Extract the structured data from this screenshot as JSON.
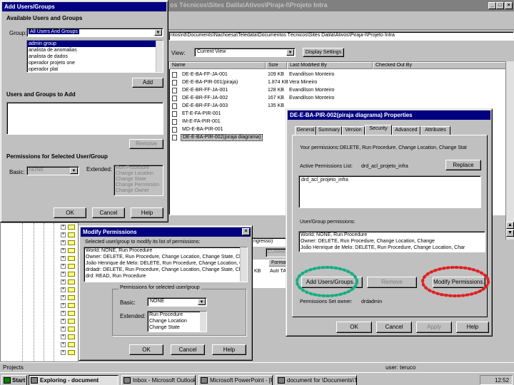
{
  "explorer": {
    "title_fragment": "os Técnicos\\Sites Dalila\\Ativos\\Piraja-I\\Projeto Intra",
    "address_fragment": "ntos\\rd\\Documents\\Nachoesa\\Teledata\\Documentos Técnicos\\Sites Dalila\\Ativos\\Piraja-I\\Projeto Intra",
    "view_label": "View:",
    "view_value": "Current View",
    "display_settings": "Display Settings",
    "columns": {
      "name": "Name",
      "size": "Size",
      "modified_by": "Last Modified By",
      "checked_out_by": "Checked Out By"
    },
    "files": [
      {
        "name": "DE-E-BA-FF-JA-001",
        "size": "109 KB",
        "by": "Evandilson Monteiro"
      },
      {
        "name": "DE-E-BA-PIR-001(piraja)",
        "size": "1.874 KB",
        "by": "Vera Mineiro"
      },
      {
        "name": "DE-E-BR-FF-JA-001",
        "size": "128 KB",
        "by": "Evandilson Monteiro"
      },
      {
        "name": "DE-E-BR-FF-JA-002",
        "size": "167 KB",
        "by": "Evandilson Monteiro"
      },
      {
        "name": "DE-E-BR-FF-JA-003",
        "size": "135 KB",
        "by": ""
      },
      {
        "name": "ET-E-FA-PIR-001",
        "size": "",
        "by": ""
      },
      {
        "name": "IM-E-FA-PIR-001",
        "size": "",
        "by": ""
      },
      {
        "name": "MD-E-BA-PIR-001",
        "size": "",
        "by": ""
      },
      {
        "name": "DE-E-BA-PIR-002(piraja diagrama)",
        "size": "",
        "by": ""
      }
    ],
    "lower_tab_fragment": "ngresso)",
    "lower_header_fragment": "Forma",
    "lower_input_value": "CURRE",
    "lower_row": {
      "size": "KB",
      "author": "Autr TA"
    },
    "status_left": "Projects",
    "status_right": "user: teruco"
  },
  "add_users": {
    "title": "Add Users/Groups",
    "available_label": "Available Users and Groups",
    "group_label": "Group:",
    "group_value": "All Users And Groups",
    "users": [
      "admin group",
      "analista de anomalias",
      "analista de dados",
      "operador projeto one",
      "operador plat"
    ],
    "add_button": "Add",
    "users_to_add_label": "Users and Groups to Add",
    "remove_button": "Remove",
    "permissions_label": "Permissions for Selected User/Group",
    "basic_label": "Basic:",
    "basic_value": "NONE",
    "extended_label": "Extended:",
    "extended_items": [
      "Run Procedure",
      "Change Location",
      "Change State",
      "Change Permission",
      "Change Owner"
    ],
    "ok": "OK",
    "cancel": "Cancel",
    "help": "Help"
  },
  "modify": {
    "title": "Modify Permissions",
    "list_label": "Selected user/group to modify its list of permissions:",
    "entries": [
      "World: NONE, Run Procedure",
      "Owner: DELETE, Run Procedure, Change Location, Change State, Ch",
      "João Henrique de Melo: DELETE, Run Procedure, Change Location, C",
      "drdadr: DELETE, Run Procedure, Change Location, Change State, Cha",
      "drd: READ, Run Procedure"
    ],
    "group_label": "Permissions for selected user/group",
    "basic_label": "Basic:",
    "basic_value": "NONE",
    "extended_label": "Extended:",
    "extended_items": [
      "Run Procedure",
      "Change Location",
      "Change State"
    ],
    "ok": "OK",
    "cancel": "Cancel",
    "help": "Help"
  },
  "properties": {
    "title": "DE-E-BA-PIR-002(piraja diagrama) Properties",
    "tabs": [
      "General",
      "Summary",
      "Version",
      "Security",
      "Advanced",
      "Attributes"
    ],
    "your_permissions_label": "Your permissions:",
    "your_permissions_value": "DELETE, Run Procedure, Change Location, Change Stat",
    "active_list_label": "Active Permissions List:",
    "active_list_value": "drd_acl_projeto_infra",
    "replace_button": "Replace",
    "active_list_content": "drd_acl_projeto_infra",
    "user_group_label": "User/Group permissions:",
    "entries": [
      "World: NONE, Run Procedure",
      "Owner: DELETE, Run Procedure, Change Location, Change",
      "João Henrique de Melo: DELETE, Run Procedure, Change Location, Char"
    ],
    "add_button": "Add Users/Groups...",
    "remove_button": "Remove",
    "modify_button": "Modify Permissions...",
    "owner_label": "Permissions Set owner:",
    "owner_value": "drdadmin",
    "ok": "OK",
    "cancel": "Cancel",
    "apply": "Apply",
    "help": "Help"
  },
  "taskbar": {
    "start": "Start",
    "items": [
      "Exploring - document",
      "Inbox - Microsoft Outlook",
      "Microsoft PowerPoint - [Pr",
      "document for \\Documents\\T..."
    ],
    "clock": "12:52"
  },
  "colors": {
    "highlight_green": "#10b080",
    "highlight_red": "#e02020",
    "title_active": "#000080",
    "face": "#c0c0c0"
  }
}
